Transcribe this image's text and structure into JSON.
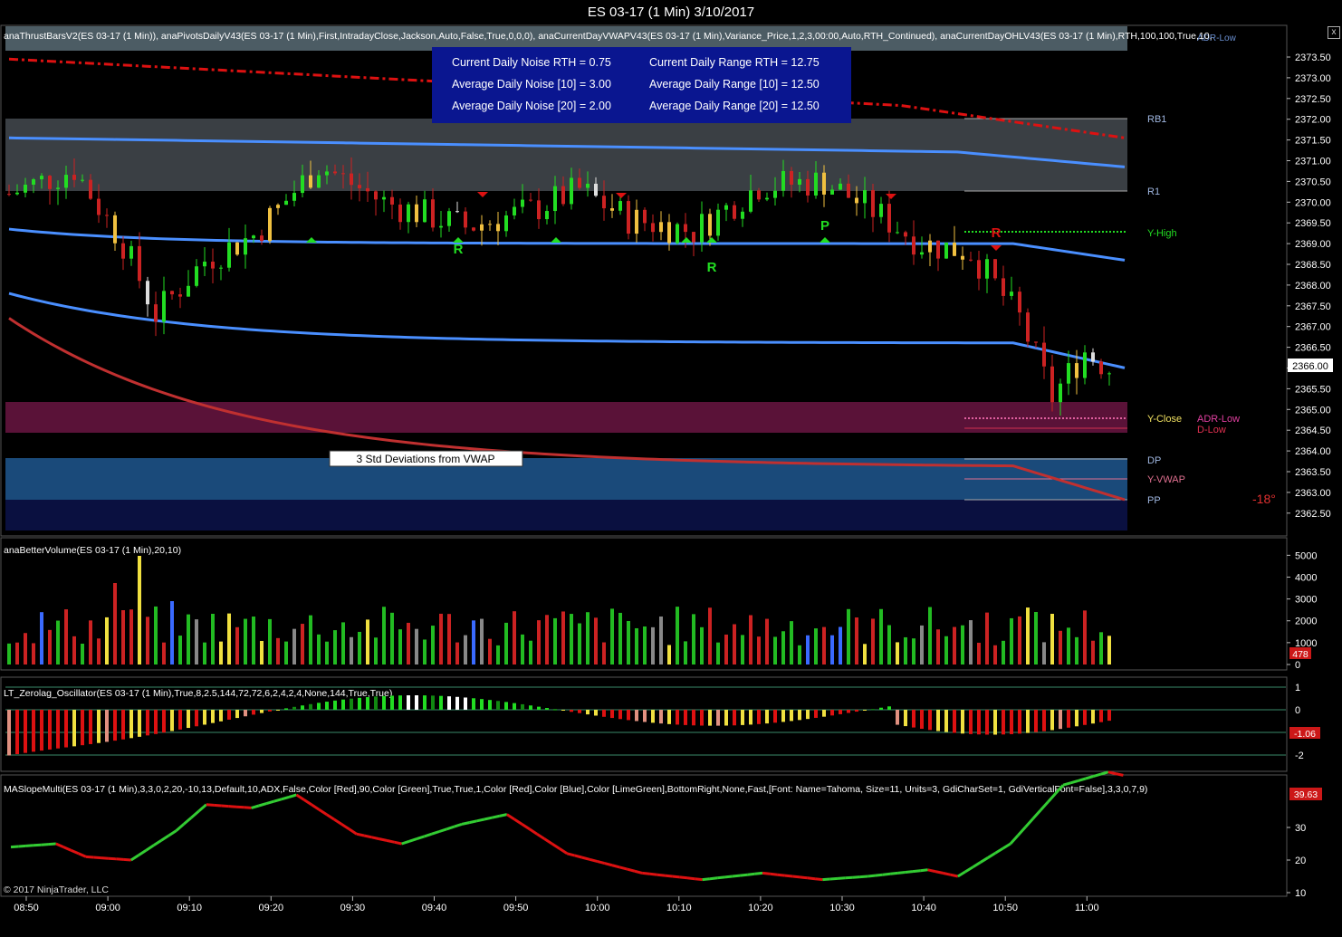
{
  "window": {
    "title": "ES 03-17 (1 Min)  3/10/2017",
    "close_glyph": "x"
  },
  "panels": {
    "price": {
      "indicator_text": "anaThrustBarsV2(ES 03-17 (1 Min)), anaPivotsDailyV43(ES 03-17 (1 Min),First,IntradayClose,Jackson,Auto,False,True,0,0,0), anaCurrentDayVWAPV43(ES 03-17 (1 Min),Variance_Price,1,2,3,00:00,Auto,RTH_Continued), anaCurrentDayOHLV43(ES 03-17 (1 Min),RTH,100,100,True,10,",
      "corner_label": "ADR-Low"
    },
    "volume": {
      "indicator_text": "anaBetterVolume(ES 03-17 (1 Min),20,10)",
      "badge": "478"
    },
    "oscillator": {
      "indicator_text": "LT_Zerolag_Oscillator(ES 03-17 (1 Min),True,8,2.5,144,72,72,6,2,4,2,4,None,144,True,True)",
      "badge": "-1.06"
    },
    "slope": {
      "indicator_text": "MASlopeMulti(ES 03-17 (1 Min),3,3,0,2,20,-10,13,Default,10,ADX,False,Color [Red],90,Color [Green],True,True,1,Color [Red],Color [Blue],Color [LimeGreen],BottomRight,None,Fast,[Font: Name=Tahoma, Size=11, Units=3, GdiCharSet=1, GdiVerticalFont=False],3,3,0,7,9)",
      "badge": "39.63"
    }
  },
  "stats_box": {
    "left": [
      "Current Daily Noise RTH = 0.75",
      "Average Daily Noise [10] = 3.00",
      "Average Daily Noise [20] = 2.00"
    ],
    "right": [
      "Current Daily Range RTH = 12.75",
      "Average Daily Range [10] = 12.50",
      "Average Daily Range [20] = 12.50"
    ]
  },
  "annotation_box": "3 Std Deviations from VWAP",
  "angle_label": "-18°",
  "copyright": "© 2017 NinjaTrader, LLC",
  "colors": {
    "up": "#22dd22",
    "down": "#cc2222",
    "vwap": "#4a8fff",
    "bands": "#c03030",
    "adr_band": "#5a1238",
    "pivot_band": "#1a4a7a"
  },
  "chart_data": {
    "type": "candlestick",
    "title": "ES 03-17 (1 Min)  3/10/2017",
    "x_ticks": [
      "08:50",
      "09:00",
      "09:10",
      "09:20",
      "09:30",
      "09:40",
      "09:50",
      "10:00",
      "10:10",
      "10:20",
      "10:30",
      "10:40",
      "10:50",
      "11:00"
    ],
    "price_axis": {
      "ticks": [
        2373.5,
        2373.0,
        2372.5,
        2372.0,
        2371.5,
        2371.0,
        2370.5,
        2370.0,
        2369.5,
        2369.0,
        2368.5,
        2368.0,
        2367.5,
        2367.0,
        2366.5,
        2366.0,
        2365.5,
        2365.0,
        2364.5,
        2364.0,
        2363.5,
        2363.0,
        2362.5
      ],
      "ylim": [
        2362.0,
        2374.0
      ],
      "last_price": "2366.00"
    },
    "levels": [
      {
        "name": "RB1",
        "value": 2372.0
      },
      {
        "name": "R1",
        "value": 2370.25
      },
      {
        "name": "Y-High",
        "value": 2369.25
      },
      {
        "name": "Y-Close",
        "value": 2364.75
      },
      {
        "name": "ADR-Low",
        "value": 2364.75
      },
      {
        "name": "D-Low",
        "value": 2364.5
      },
      {
        "name": "DP",
        "value": 2363.75
      },
      {
        "name": "Y-VWAP",
        "value": 2363.25
      },
      {
        "name": "PP",
        "value": 2362.75
      }
    ],
    "signals": [
      "R",
      "R",
      "P",
      "R",
      "R"
    ],
    "volume_axis": {
      "ticks": [
        5000,
        4000,
        3000,
        2000,
        1000,
        0
      ],
      "last": 478
    },
    "oscillator_axis": {
      "ticks": [
        1,
        0,
        -1,
        -2
      ],
      "last": -1.06
    },
    "slope_axis": {
      "ticks": [
        30,
        20,
        10
      ],
      "last": 39.63
    }
  }
}
